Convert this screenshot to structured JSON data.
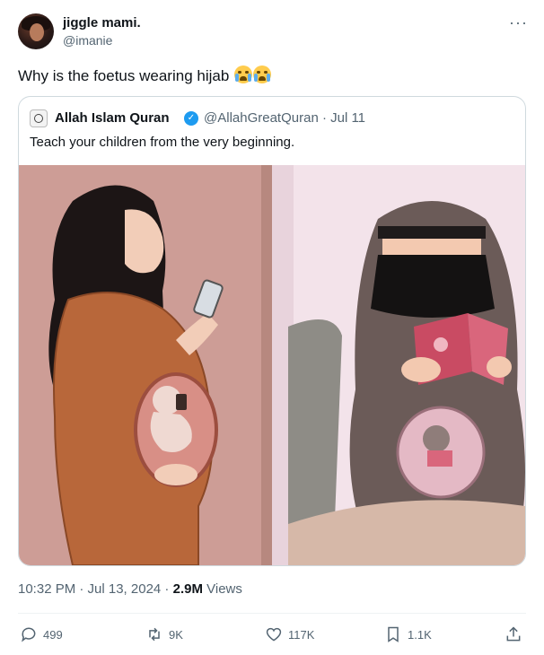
{
  "tweet": {
    "author_name": "jiggle mami.",
    "author_handle": "@imanie",
    "text": "Why is the foetus wearing hijab",
    "emojis": [
      "loudly-crying-face",
      "loudly-crying-face"
    ]
  },
  "quoted": {
    "author_name": "Allah Islam Quran",
    "author_handle_date": "@AllahGreatQuran · Jul 11",
    "text": "Teach your children from the very beginning."
  },
  "meta": {
    "timestamp": "10:32 PM · Jul 13, 2024 · ",
    "views_count": "2.9M",
    "views_label": " Views"
  },
  "actions": {
    "replies": "499",
    "reposts": "9K",
    "likes": "117K",
    "bookmarks": "1.1K"
  },
  "colors": {
    "text_primary": "#0f1419",
    "text_secondary": "#536471",
    "verified": "#1d9bf0",
    "border": "#cfd9de"
  }
}
